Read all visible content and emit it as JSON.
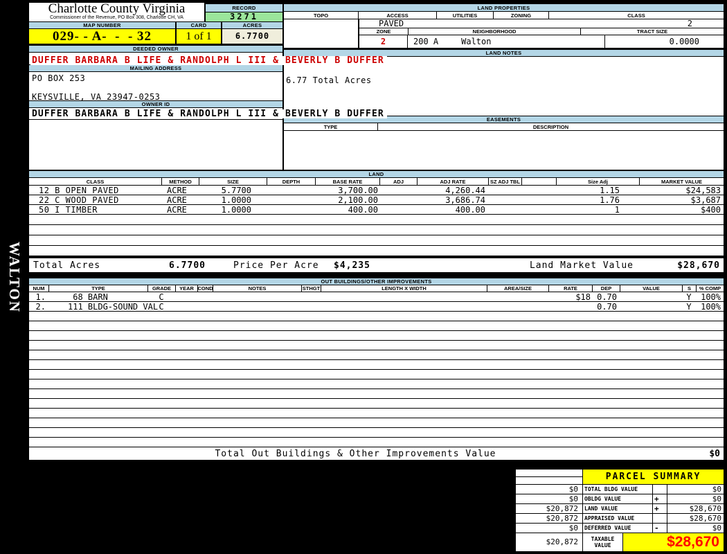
{
  "colors": {
    "section_bar_blue": "#B3D6E6",
    "highlight_yellow": "#FFFF00",
    "record_green": "#9BE69B",
    "acres_cream": "#F0EEDC",
    "owner_red": "#CC0000",
    "taxable_red": "#FF0000"
  },
  "header": {
    "county": "Charlotte County Virginia",
    "commissioner": "Commissioner of the Revenue, PO Box 308, Charlotte CH, VA",
    "record_label": "RECORD",
    "record_value": "3271",
    "map_number_label": "MAP NUMBER",
    "map_number": "029- - A-  -  - 32",
    "card_label": "CARD",
    "card_value": "1 of 1",
    "acres_label": "ACRES",
    "acres_value": "6.7700"
  },
  "owner": {
    "deeded_owner_label": "DEEDED OWNER",
    "deeded_owner": "DUFFER BARBARA B LIFE & RANDOLPH L III & BEVERLY B DUFFER",
    "mailing_label": "MAILING ADDRESS",
    "mailing_line1": "PO BOX 253",
    "mailing_line2": "KEYSVILLE, VA 23947-0253",
    "owner_id_label": "OWNER ID",
    "owner_id": "DUFFER BARBARA B LIFE & RANDOLPH L III & BEVERLY B DUFFER"
  },
  "land_properties": {
    "title": "LAND PROPERTIES",
    "headers": [
      "TOPO",
      "ACCESS",
      "UTILITIES",
      "ZONING",
      "CLASS"
    ],
    "access_value": "PAVED",
    "class_value": "2",
    "zone_label": "ZONE",
    "zone_value": "2",
    "neighborhood_label": "NEIGHBORHOOD",
    "neighborhood_code": "200 A",
    "neighborhood_name": "Walton",
    "tract_size_label": "TRACT SIZE",
    "tract_size_value": "0.0000"
  },
  "land_notes": {
    "title": "LAND NOTES",
    "note": "6.77 Total Acres"
  },
  "easements": {
    "title": "EASEMENTS",
    "type_label": "TYPE",
    "description_label": "DESCRIPTION"
  },
  "land": {
    "title": "LAND",
    "headers": [
      "CLASS",
      "METHOD",
      "SIZE",
      "DEPTH",
      "BASE RATE",
      "ADJ",
      "ADJ RATE",
      "SZ ADJ TBL",
      "",
      "Size Adj",
      "MARKET VALUE"
    ],
    "rows": [
      {
        "class": "12 B OPEN PAVED",
        "method": "ACRE",
        "size": "5.7700",
        "base_rate": "3,700.00",
        "adj_rate": "4,260.44",
        "size_adj": "1.15",
        "market_value": "$24,583"
      },
      {
        "class": "22 C WOOD PAVED",
        "method": "ACRE",
        "size": "1.0000",
        "base_rate": "2,100.00",
        "adj_rate": "3,686.74",
        "size_adj": "1.76",
        "market_value": "$3,687"
      },
      {
        "class": "50 I TIMBER",
        "method": "ACRE",
        "size": "1.0000",
        "base_rate": "400.00",
        "adj_rate": "400.00",
        "size_adj": "1",
        "market_value": "$400"
      }
    ],
    "total_acres_label": "Total Acres",
    "total_acres": "6.7700",
    "price_per_acre_label": "Price Per Acre",
    "price_per_acre": "$4,235",
    "market_value_label": "Land Market Value",
    "market_value": "$28,670"
  },
  "out_buildings": {
    "title": "OUT BUILDINGS/OTHER IMPROVEMENTS",
    "headers": [
      "NUM",
      "TYPE",
      "GRADE",
      "YEAR",
      "COND",
      "NOTES",
      "STHGT",
      "LENGTH X WIDTH",
      "AREA/SIZE",
      "RATE",
      "DEP",
      "VALUE",
      "S",
      "% COMP"
    ],
    "rows": [
      {
        "num": "1.",
        "type": " 68 BARN",
        "grade": "C",
        "rate": "$18",
        "dep": "0.70",
        "s": "Y",
        "comp": "100%"
      },
      {
        "num": "2.",
        "type": "111 BLDG-SOUND VAL",
        "grade": "C",
        "rate": "",
        "dep": "0.70",
        "s": "Y",
        "comp": "100%"
      }
    ],
    "total_label": "Total Out Buildings & Other Improvements Value",
    "total_value": "$0"
  },
  "sidebar": {
    "district": "WALTON"
  },
  "parcel_summary": {
    "title": "PARCEL SUMMARY",
    "rows": [
      {
        "left": "$0",
        "label": "TOTAL BLDG VALUE",
        "op": "",
        "right": "$0"
      },
      {
        "left": "$0",
        "label": "OBLDG VALUE",
        "op": "+",
        "right": "$0"
      },
      {
        "left": "$20,872",
        "label": "LAND VALUE",
        "op": "+",
        "right": "$28,670"
      },
      {
        "left": "$20,872",
        "label": "APPRAISED VALUE",
        "op": "",
        "right": "$28,670"
      },
      {
        "left": "$0",
        "label": "DEFERRED VALUE",
        "op": "-",
        "right": "$0"
      }
    ],
    "taxable": {
      "left": "$20,872",
      "label_line1": "TAXABLE",
      "label_line2": "VALUE",
      "value": "$28,670"
    }
  }
}
